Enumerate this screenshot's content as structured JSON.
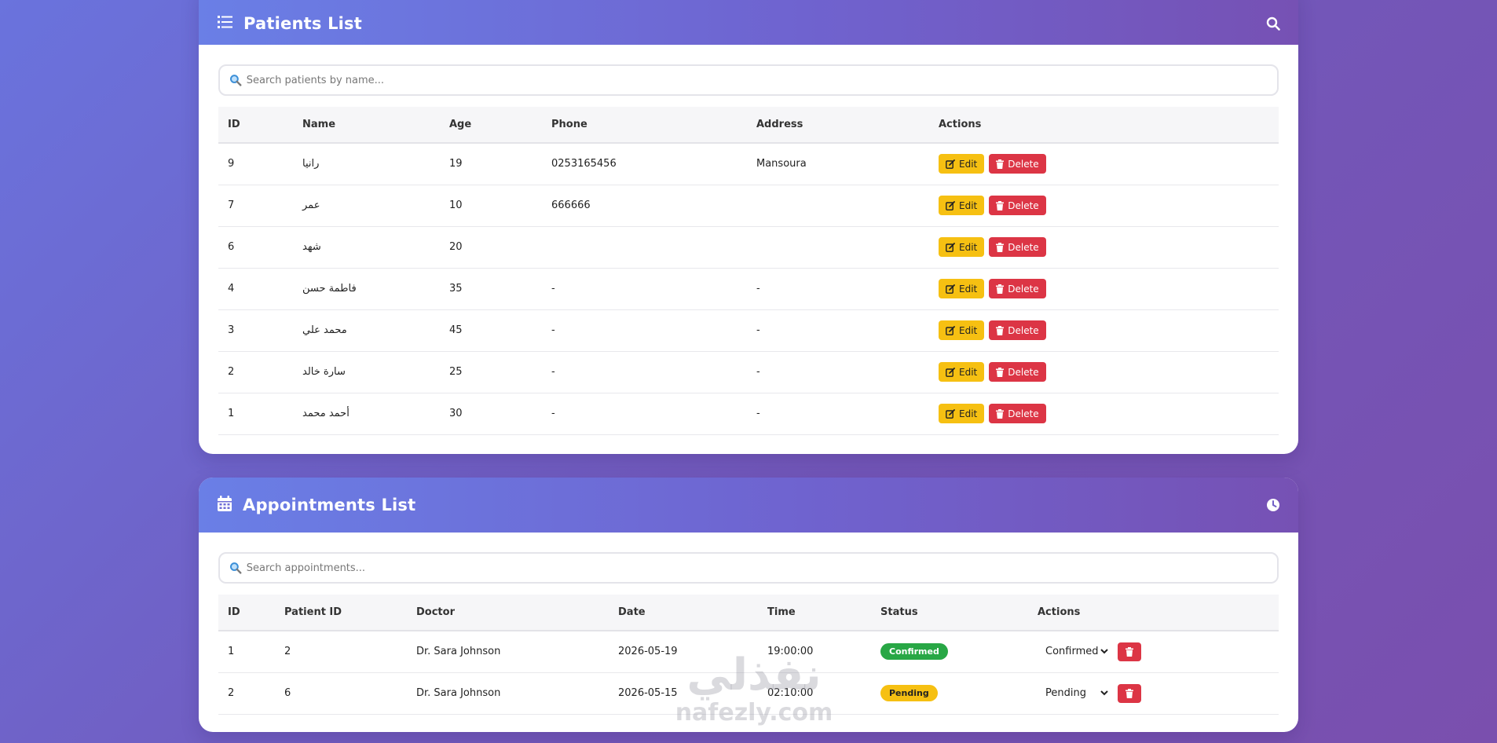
{
  "patients": {
    "title": "Patients List",
    "search_placeholder": "Search patients by name...",
    "columns": [
      "ID",
      "Name",
      "Age",
      "Phone",
      "Address",
      "Actions"
    ],
    "edit_label": "Edit",
    "delete_label": "Delete",
    "rows": [
      {
        "id": "9",
        "name": "رانيا",
        "age": "19",
        "phone": "0253165456",
        "address": "Mansoura"
      },
      {
        "id": "7",
        "name": "عمر",
        "age": "10",
        "phone": "666666",
        "address": ""
      },
      {
        "id": "6",
        "name": "شهد",
        "age": "20",
        "phone": "",
        "address": ""
      },
      {
        "id": "4",
        "name": "فاطمة حسن",
        "age": "35",
        "phone": "-",
        "address": "-"
      },
      {
        "id": "3",
        "name": "محمد علي",
        "age": "45",
        "phone": "-",
        "address": "-"
      },
      {
        "id": "2",
        "name": "سارة خالد",
        "age": "25",
        "phone": "-",
        "address": "-"
      },
      {
        "id": "1",
        "name": "أحمد محمد",
        "age": "30",
        "phone": "-",
        "address": "-"
      }
    ]
  },
  "appointments": {
    "title": "Appointments List",
    "search_placeholder": "Search appointments...",
    "columns": [
      "ID",
      "Patient ID",
      "Doctor",
      "Date",
      "Time",
      "Status",
      "Actions"
    ],
    "rows": [
      {
        "id": "1",
        "patient_id": "2",
        "doctor": "Dr. Sara Johnson",
        "date": "2026-05-19",
        "time": "19:00:00",
        "status": "Confirmed",
        "status_select": "Confirmed"
      },
      {
        "id": "2",
        "patient_id": "6",
        "doctor": "Dr. Sara Johnson",
        "date": "2026-05-15",
        "time": "02:10:00",
        "status": "Pending",
        "status_select": "Pending"
      }
    ]
  },
  "watermark": {
    "arabic": "نفذلي",
    "latin": "nafezly.com"
  },
  "colors": {
    "header_gradient_start": "#6a7fe6",
    "header_gradient_end": "#7651b4",
    "edit": "#f6c012",
    "delete": "#dc3545",
    "confirmed": "#28a745",
    "pending": "#f6c012"
  },
  "icons": {
    "patients_header": "list-icon",
    "patients_header_right": "search-icon",
    "appointments_header": "calendar-icon",
    "appointments_header_right": "clock-icon"
  }
}
